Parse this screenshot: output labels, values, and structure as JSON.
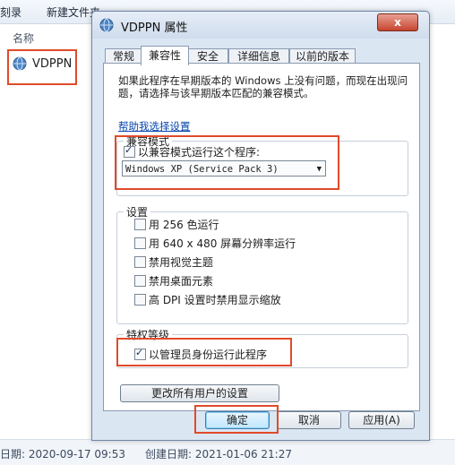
{
  "explorer": {
    "toolbar": {
      "burn_partial": "刻录",
      "new_folder_partial": "新建文件夹"
    },
    "column_header": "名称",
    "file_name": "VDPPN",
    "status": {
      "modified_partial": "日期: 2020-09-17 09:53",
      "created": "创建日期: 2021-01-06 21:27"
    }
  },
  "dialog": {
    "title": "VDPPN 属性",
    "close": "x",
    "tabs": [
      "常规",
      "兼容性",
      "安全",
      "详细信息",
      "以前的版本"
    ],
    "active_tab": 1,
    "description": "如果此程序在早期版本的 Windows 上没有问题，而现在出现问题，请选择与该早期版本匹配的兼容模式。",
    "help_link": "帮助我选择设置",
    "compat_group": {
      "title": "兼容模式",
      "checkbox_label": "以兼容模式运行这个程序:",
      "checked": true,
      "selected_os": "Windows XP (Service Pack 3)"
    },
    "settings_group": {
      "title": "设置",
      "options": [
        {
          "label": "用 256 色运行",
          "checked": false
        },
        {
          "label": "用 640 x 480 屏幕分辨率运行",
          "checked": false
        },
        {
          "label": "禁用视觉主题",
          "checked": false
        },
        {
          "label": "禁用桌面元素",
          "checked": false
        },
        {
          "label": "高 DPI 设置时禁用显示缩放",
          "checked": false
        }
      ]
    },
    "privilege_group": {
      "title": "特权等级",
      "checkbox_label": "以管理员身份运行此程序",
      "checked": true
    },
    "all_users_button": "更改所有用户的设置",
    "buttons": {
      "ok": "确定",
      "cancel": "取消",
      "apply": "应用(A)"
    }
  },
  "colors": {
    "highlight": "#e04b2a",
    "link": "#0645ad",
    "dialog_frame": "#dbe6f3"
  }
}
